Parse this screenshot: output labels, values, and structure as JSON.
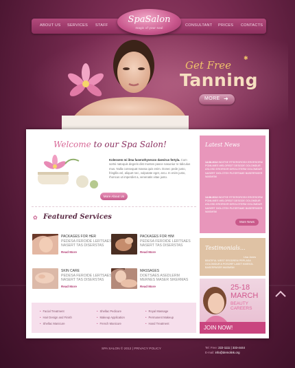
{
  "nav": {
    "left": [
      "About Us",
      "Services",
      "Staff"
    ],
    "right": [
      "Consultant",
      "Prices",
      "Contacts"
    ]
  },
  "logo": {
    "title": "SpaSalon",
    "tagline": "magic of your soul"
  },
  "hero": {
    "line1": "Get Free",
    "line2": "Tanning",
    "more": "MORE"
  },
  "welcome": {
    "prefix": "Welcome",
    "suffix": " to our Spa Salon!"
  },
  "intro": {
    "bold": "Kolessem mi ilma faseruthyvecoo daevirus fertyla.",
    "body": "Cum sortsi natoquis degeris dist montes pasce nasuniur re tidiculus mus. Nulla consequat massa quis enim. Donec pede justo, fringilla vel, aliquet nec, vulputate eget, arcu. In enim justo, rhoncus ut imperdiet a, venenatis vitae justo.",
    "button": "More About Us"
  },
  "featured": {
    "title": "Featured Services",
    "read_more": "Read More",
    "items": [
      {
        "title": "Packages for her",
        "desc": "Pedesa feroide lertsaes nasert tas diserstas"
      },
      {
        "title": "Packages for him",
        "desc": "Pedesa feroide lertsaes nasert tas diserstas"
      },
      {
        "title": "Skin care",
        "desc": "Pedesa feroide lertsaes nasert tas diserstas"
      },
      {
        "title": "Massages",
        "desc": "Doetsaes asedlerm mernes maser sikermas"
      }
    ]
  },
  "service_list": [
    [
      "Facial Treatment",
      "Hair Design and Finish",
      "Shellac Manicure"
    ],
    [
      "Shellac Pedicure",
      "Makeup Application",
      "French Manicure"
    ],
    [
      "Royal Massage",
      "Permanent Makeup",
      "Hand Treatment"
    ]
  ],
  "news": {
    "title": "Latest News",
    "button": "More News",
    "items": [
      {
        "date": "14.08.2012",
        "text": "Inditse rtsergrosh erorsorm pomlimes welorsdt desgde oolomdur aslosd erorsor diroloterm oolomdur nasert dioloteh plesrtame baserpaser wasmsm"
      },
      {
        "date": "14.08.2012",
        "text": "Inditse rtsergrosh erorsorm pomlimes welorsdt desgde oolomdur aslosd erorsor diroloterm oolomdur nasert dioloteh plesrtame baserpaser wasmsm"
      }
    ]
  },
  "testimonials": {
    "title": "Testimonials...",
    "name": "Lisa Jones",
    "text": "Beatiful west erodrem prplasa oolomdur a posorf laset kmesol baserpaser wasmsm"
  },
  "promo": {
    "dates": "25-18",
    "month": "MARCH",
    "sub1": "BEAUTY",
    "sub2": "CAREERS",
    "cta": "JOIN NOW!"
  },
  "footer": {
    "copyright": "SPA SALON © 2012  |  PRIVACY POLICY",
    "tel_label": "Tel: Free:",
    "tel": "222-1111  |  333-4444",
    "email_label": "E-mail:",
    "email": "info@demolink.org"
  }
}
